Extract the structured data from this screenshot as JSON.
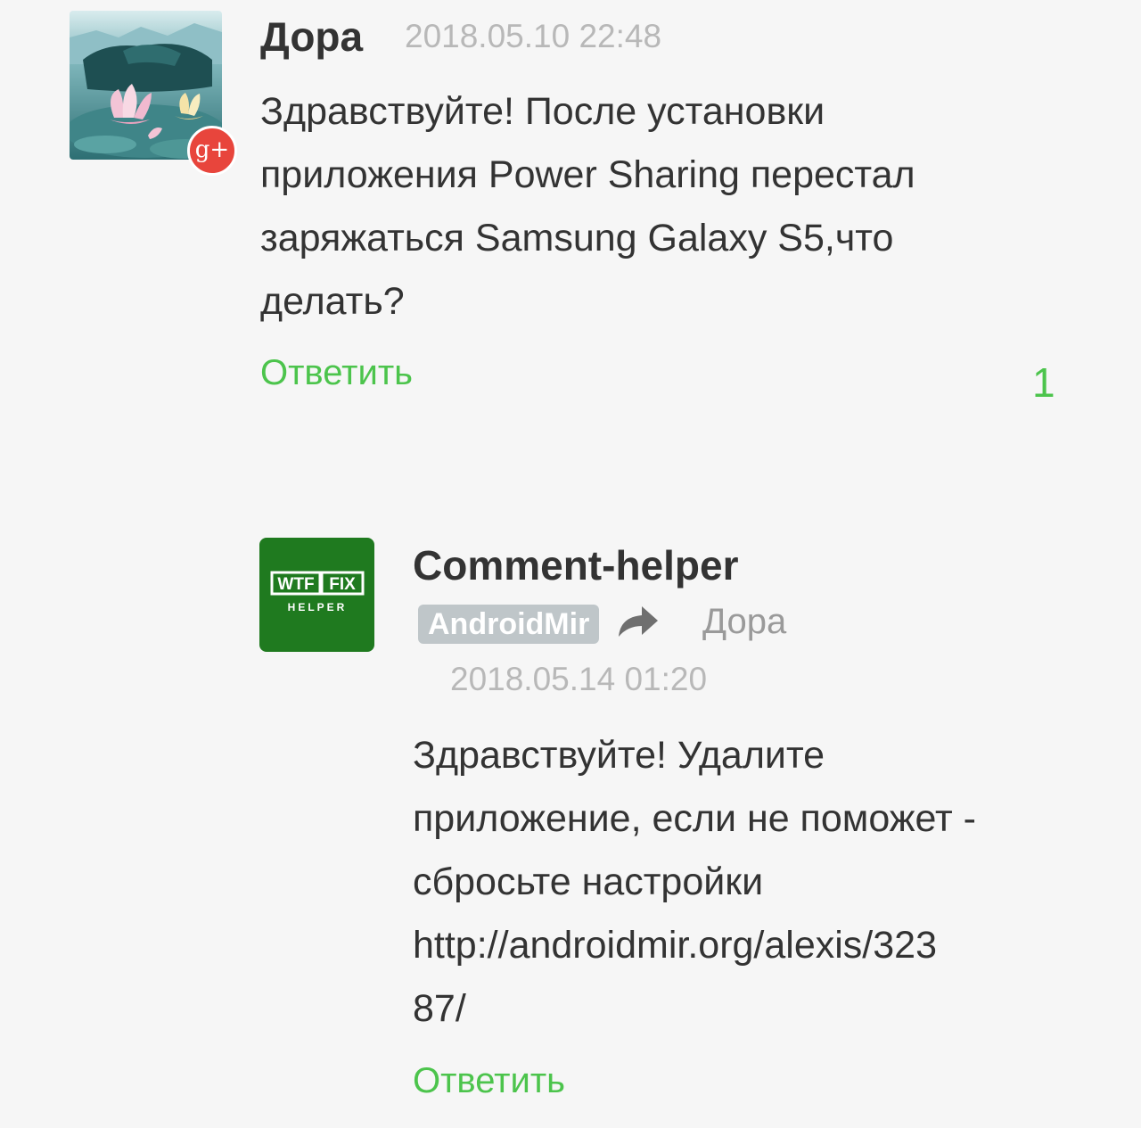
{
  "comment": {
    "author": "Дора",
    "timestamp": "2018.05.10 22:48",
    "text": "Здравствуйте! После установки\nприложения Power Sharing перестал\nзаряжаться Samsung Galaxy S5,что\nделать?",
    "reply_label": "Ответить",
    "likes": "1",
    "social_badge_glyph": "g+",
    "social_badge_icon": "google-plus-icon"
  },
  "reply": {
    "author": "Comment-helper",
    "site_badge": "AndroidMir",
    "reply_to_icon": "share-arrow-icon",
    "reply_to": "Дора",
    "timestamp": "2018.05.14 01:20",
    "text": "Здравствуйте! Удалите\nприложение, если не поможет -\nсбросьте настройки\nhttp://androidmir.org/alexis/323\n87/",
    "reply_label": "Ответить",
    "avatar_logo": {
      "box1": "WTF",
      "box2": "FIX",
      "subtitle": "HELPER"
    }
  },
  "colors": {
    "background": "#f6f6f6",
    "accent_green": "#4cc44c",
    "text_dark": "#333333",
    "text_muted": "#b8b8b8",
    "gplus_red": "#e8453c",
    "helper_avatar_green": "#1f7a1f",
    "site_badge_gray": "#bfc6c9"
  }
}
